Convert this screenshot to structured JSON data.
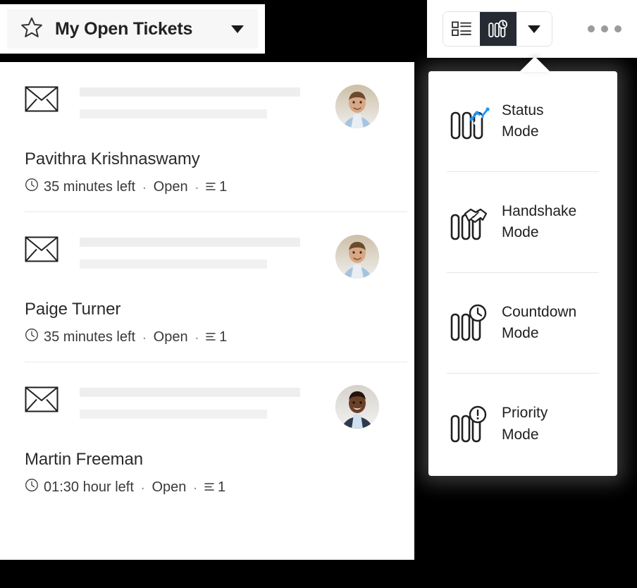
{
  "view_header": {
    "star_icon": "star-outline-icon",
    "title": "My Open Tickets",
    "caret_icon": "chevron-down-icon"
  },
  "toolbar": {
    "list_view_button": {
      "icon": "list-view-icon",
      "label": "List View",
      "active": false
    },
    "mode_view_button": {
      "icon": "countdown-bars-icon",
      "label": "Countdown Mode",
      "active": true
    },
    "dropdown_button": {
      "icon": "chevron-down-icon",
      "label": "More view modes"
    },
    "overflow_button": {
      "icon": "ellipsis-horizontal-icon",
      "label": "More options",
      "dot_color": "#9b9b9b"
    }
  },
  "mode_menu": {
    "items": [
      {
        "icon": "status-bars-icon",
        "line1": "Status",
        "line2": "Mode",
        "accent": "#2196f3"
      },
      {
        "icon": "handshake-bars-icon",
        "line1": "Handshake",
        "line2": "Mode",
        "accent": "#1f1f1f"
      },
      {
        "icon": "countdown-bars-icon",
        "line1": "Countdown",
        "line2": "Mode",
        "accent": "#1f1f1f"
      },
      {
        "icon": "priority-bars-icon",
        "line1": "Priority",
        "line2": "Mode",
        "accent": "#1f1f1f"
      }
    ]
  },
  "tickets": [
    {
      "channel_icon": "envelope-icon",
      "name": "Pavithra Krishnaswamy",
      "time_icon": "clock-icon",
      "time_left": "35 minutes left",
      "separator": ".",
      "status": "Open",
      "thread_icon": "thread-lines-icon",
      "thread_count": "1",
      "avatar": "avatar-photo-male-1"
    },
    {
      "channel_icon": "envelope-icon",
      "name": "Paige Turner",
      "time_icon": "clock-icon",
      "time_left": "35 minutes left",
      "separator": ".",
      "status": "Open",
      "thread_icon": "thread-lines-icon",
      "thread_count": "1",
      "avatar": "avatar-photo-male-1"
    },
    {
      "channel_icon": "envelope-icon",
      "name": "Martin Freeman",
      "time_icon": "clock-icon",
      "time_left": "01:30 hour left",
      "separator": ".",
      "status": "Open",
      "thread_icon": "thread-lines-icon",
      "thread_count": "1",
      "avatar": "avatar-photo-male-2"
    }
  ],
  "colors": {
    "page_background": "#000000",
    "card_background": "#ffffff",
    "active_segment": "#262b33",
    "accent_blue": "#2196f3",
    "skeleton_grey": "#eeeeee",
    "divider": "#e6e6e6"
  }
}
